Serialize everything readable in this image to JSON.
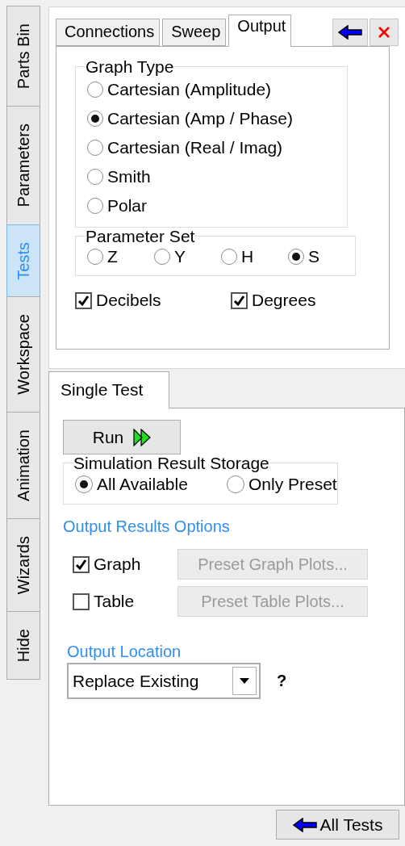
{
  "side_tabs": [
    {
      "label": "Parts Bin",
      "selected": false
    },
    {
      "label": "Parameters",
      "selected": false
    },
    {
      "label": "Tests",
      "selected": true
    },
    {
      "label": "Workspace",
      "selected": false
    },
    {
      "label": "Animation",
      "selected": false
    },
    {
      "label": "Wizards",
      "selected": false
    },
    {
      "label": "Hide",
      "selected": false
    }
  ],
  "output_panel": {
    "tabs": [
      {
        "label": "Connections",
        "selected": false
      },
      {
        "label": "Sweep",
        "selected": false
      },
      {
        "label": "Output",
        "selected": true
      }
    ],
    "graph_type": {
      "title": "Graph Type",
      "options": [
        {
          "label": "Cartesian (Amplitude)",
          "selected": false
        },
        {
          "label": "Cartesian (Amp / Phase)",
          "selected": true
        },
        {
          "label": "Cartesian (Real / Imag)",
          "selected": false
        },
        {
          "label": "Smith",
          "selected": false
        },
        {
          "label": "Polar",
          "selected": false
        }
      ]
    },
    "parameter_set": {
      "title": "Parameter Set",
      "options": [
        {
          "label": "Z",
          "selected": false
        },
        {
          "label": "Y",
          "selected": false
        },
        {
          "label": "H",
          "selected": false
        },
        {
          "label": "S",
          "selected": true
        }
      ]
    },
    "checkboxes": [
      {
        "label": "Decibels",
        "checked": true
      },
      {
        "label": "Degrees",
        "checked": true
      }
    ]
  },
  "single_test": {
    "tab": {
      "label": "Single Test",
      "selected": true
    },
    "run_button": {
      "label": "Run"
    },
    "storage": {
      "title": "Simulation Result Storage",
      "options": [
        {
          "label": "All Available",
          "selected": true
        },
        {
          "label": "Only Preset",
          "selected": false
        }
      ]
    },
    "output_results_options": {
      "title": "Output Results Options",
      "items": [
        {
          "label": "Graph",
          "checked": true,
          "button": {
            "label": "Preset Graph Plots...",
            "disabled": true
          }
        },
        {
          "label": "Table",
          "checked": false,
          "button": {
            "label": "Preset Table Plots...",
            "disabled": true
          }
        }
      ]
    },
    "output_location": {
      "title": "Output Location",
      "value": "Replace Existing",
      "help": "?"
    }
  },
  "all_tests_button": {
    "label": "All Tests"
  }
}
